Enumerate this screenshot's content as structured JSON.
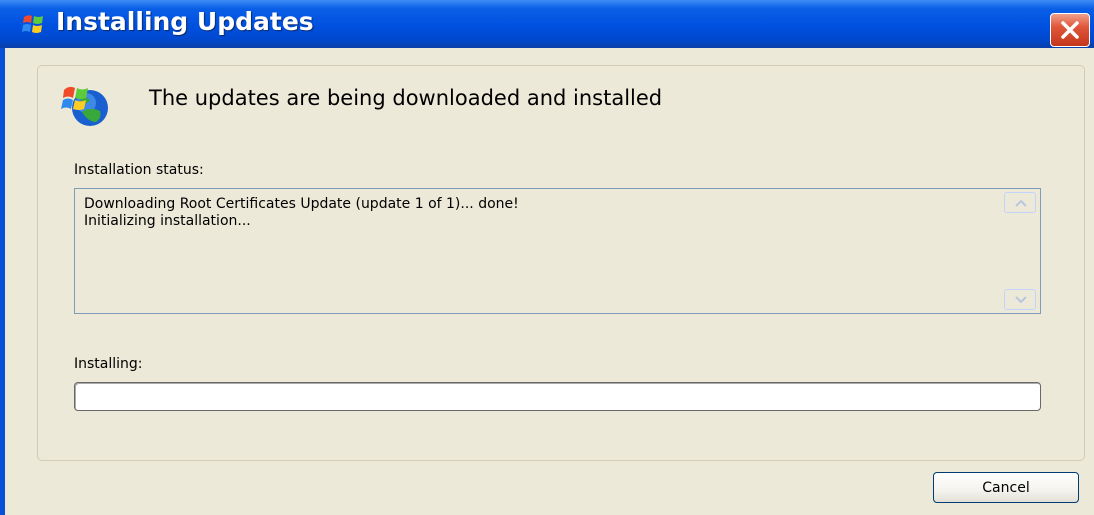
{
  "window": {
    "title": "Installing Updates",
    "title_icon": "windows-update-icon",
    "close_icon": "close-icon"
  },
  "header": {
    "icon": "windows-update-globe-icon",
    "text": "The updates are being downloaded and installed"
  },
  "status": {
    "label": "Installation status:",
    "lines": "Downloading Root Certificates Update (update 1 of 1)... done!\nInitializing installation..."
  },
  "install": {
    "label": "Installing:",
    "progress_percent": 0
  },
  "buttons": {
    "cancel": "Cancel"
  },
  "colors": {
    "titlebar": "#0050e0",
    "client_bg": "#ece9d8",
    "close_button": "#e0573a"
  }
}
